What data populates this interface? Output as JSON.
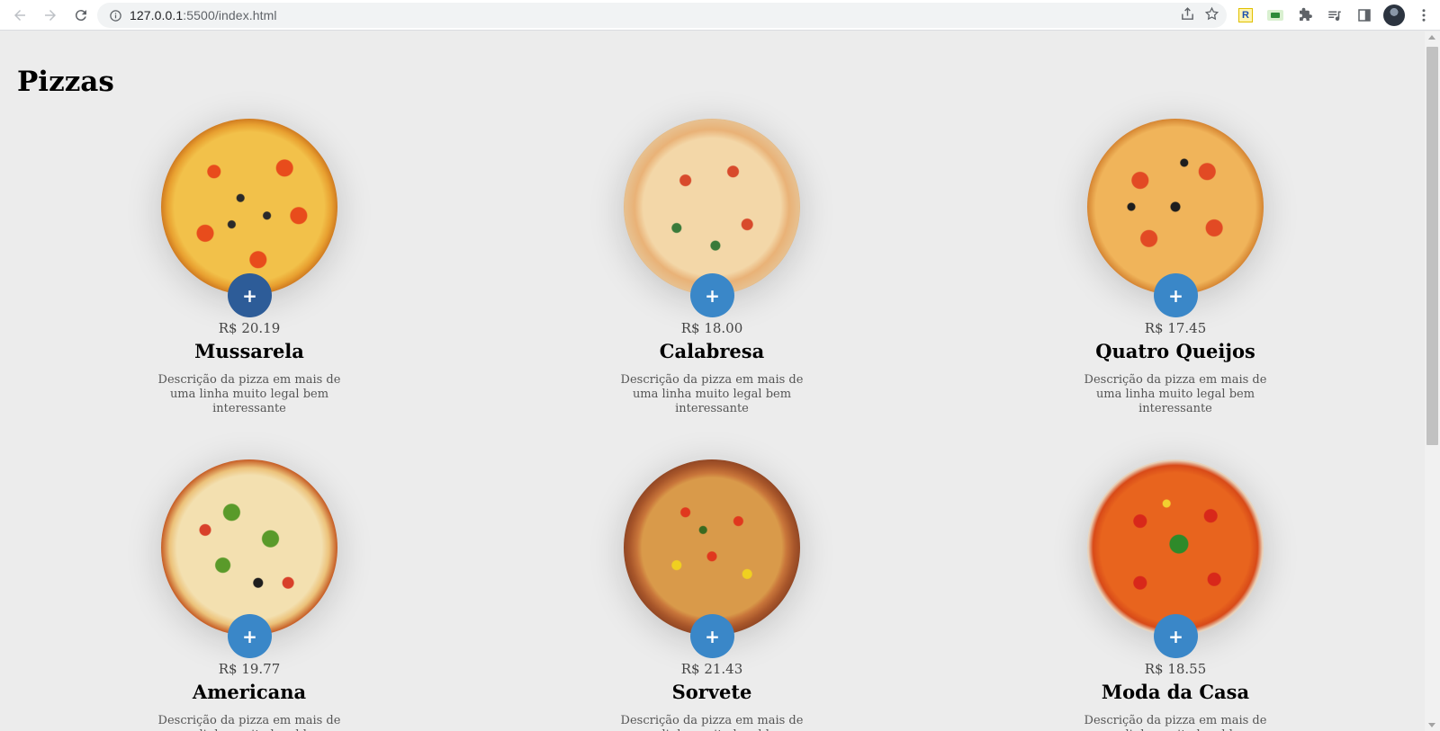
{
  "browser": {
    "url_host": "127.0.0.1",
    "url_rest": ":5500/index.html"
  },
  "page": {
    "title": "Pizzas"
  },
  "pizzas": [
    {
      "name": "Mussarela",
      "price": "R$ 20.19",
      "description": "Descrição da pizza em mais de uma linha muito legal bem interessante",
      "add_label": "+"
    },
    {
      "name": "Calabresa",
      "price": "R$ 18.00",
      "description": "Descrição da pizza em mais de uma linha muito legal bem interessante",
      "add_label": "+"
    },
    {
      "name": "Quatro Queijos",
      "price": "R$ 17.45",
      "description": "Descrição da pizza em mais de uma linha muito legal bem interessante",
      "add_label": "+"
    },
    {
      "name": "Americana",
      "price": "R$ 19.77",
      "description": "Descrição da pizza em mais de uma linha muito legal bem interessante",
      "add_label": "+"
    },
    {
      "name": "Sorvete",
      "price": "R$ 21.43",
      "description": "Descrição da pizza em mais de uma linha muito legal bem interessante",
      "add_label": "+"
    },
    {
      "name": "Moda da Casa",
      "price": "R$ 18.55",
      "description": "Descrição da pizza em mais de uma linha muito legal bem interessante",
      "add_label": "+"
    }
  ],
  "colors": {
    "accent": "#3a87c8",
    "accent_active": "#2d5c98",
    "page_background": "#ececec"
  }
}
